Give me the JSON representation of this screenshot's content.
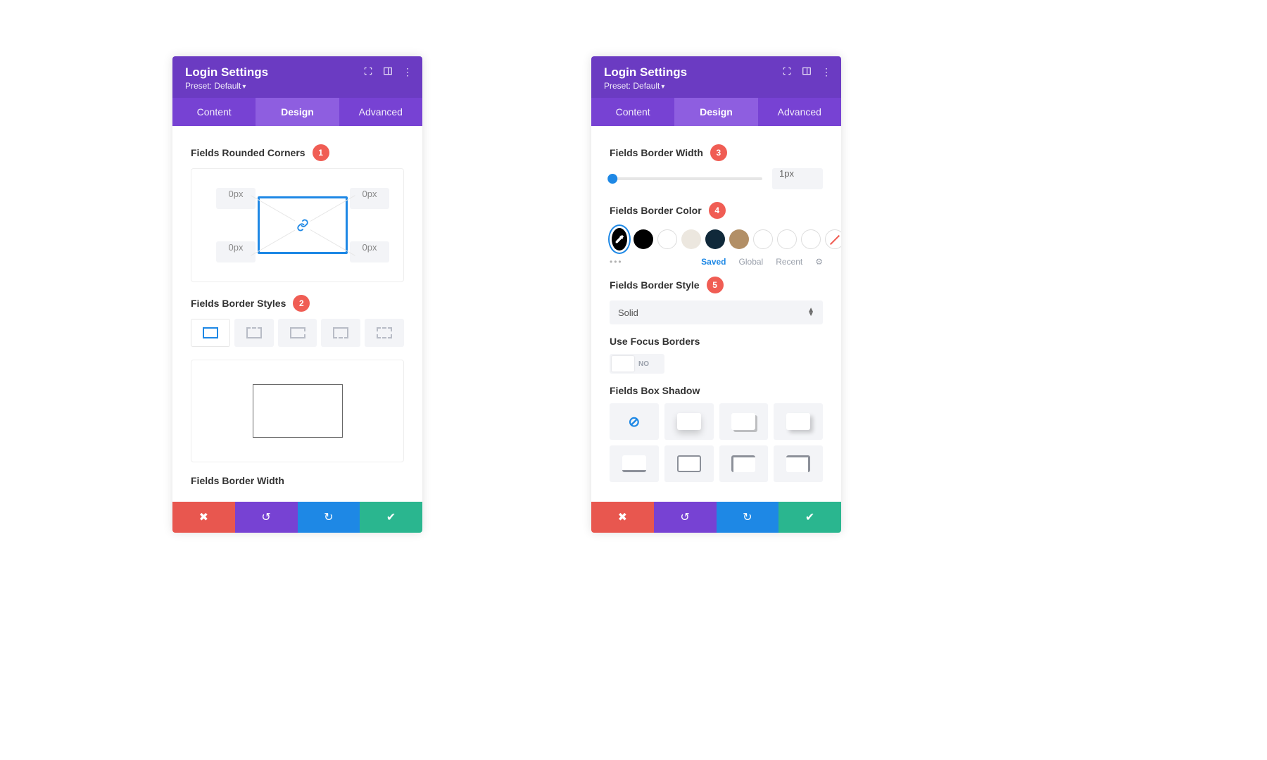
{
  "header": {
    "title": "Login Settings",
    "preset": "Preset: Default"
  },
  "tabs": {
    "content": "Content",
    "design": "Design",
    "advanced": "Advanced"
  },
  "left": {
    "rounded_label": "Fields Rounded Corners",
    "corners": {
      "tl": "0px",
      "tr": "0px",
      "bl": "0px",
      "br": "0px"
    },
    "styles_label": "Fields Border Styles",
    "width_label_cut": "Fields Border Width"
  },
  "right": {
    "width_label": "Fields Border Width",
    "width_value": "1px",
    "color_label": "Fields Border Color",
    "color_tabs": {
      "saved": "Saved",
      "global": "Global",
      "recent": "Recent"
    },
    "swatches": [
      {
        "bg": "#000000"
      },
      {
        "bg": "#ffffff",
        "hollow": true
      },
      {
        "bg": "#ece7df"
      },
      {
        "bg": "#10293a"
      },
      {
        "bg": "#b28f66"
      },
      {
        "bg": "#ffffff",
        "hollow": true
      },
      {
        "bg": "#ffffff",
        "hollow": true
      },
      {
        "bg": "#ffffff",
        "hollow": true
      }
    ],
    "style_label": "Fields Border Style",
    "style_value": "Solid",
    "focus_label": "Use Focus Borders",
    "focus_value": "NO",
    "shadow_label": "Fields Box Shadow"
  },
  "badges": {
    "b1": "1",
    "b2": "2",
    "b3": "3",
    "b4": "4",
    "b5": "5"
  }
}
